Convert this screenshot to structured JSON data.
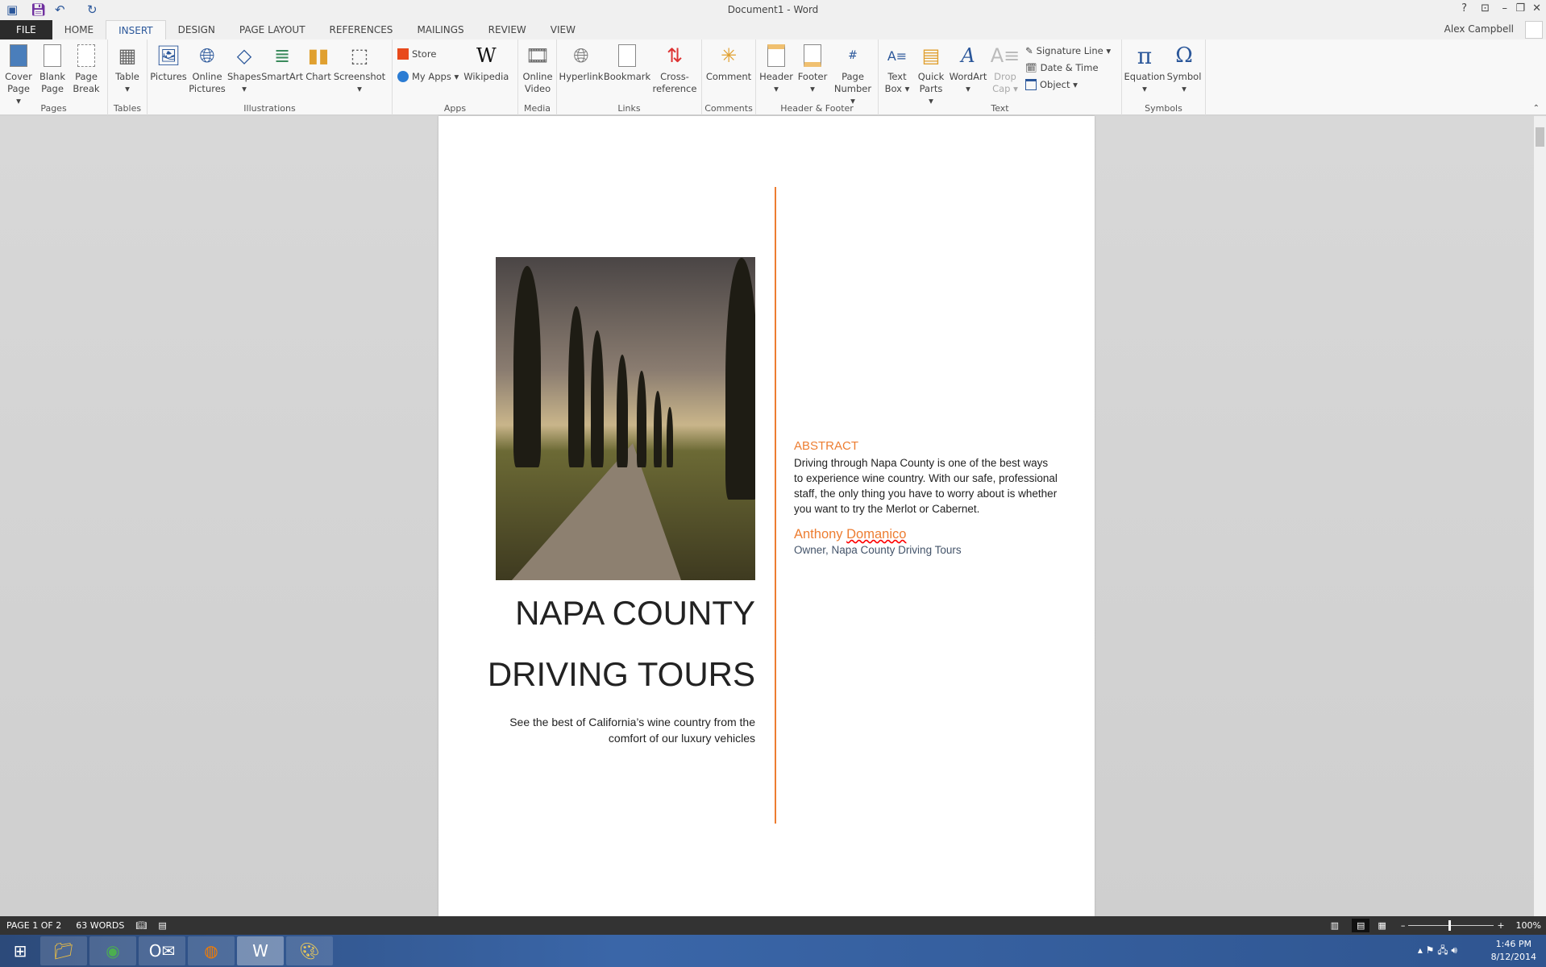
{
  "window": {
    "title": "Document1 - Word",
    "user": "Alex Campbell",
    "help": "?",
    "minimize": "–",
    "restore": "❐",
    "close": "✕"
  },
  "tabs": [
    "FILE",
    "HOME",
    "INSERT",
    "DESIGN",
    "PAGE LAYOUT",
    "REFERENCES",
    "MAILINGS",
    "REVIEW",
    "VIEW"
  ],
  "active_tab": "INSERT",
  "ribbon": {
    "pages": {
      "label": "Pages",
      "buttons": [
        "Cover Page ▾",
        "Blank Page",
        "Page Break"
      ]
    },
    "tables": {
      "label": "Tables",
      "buttons": [
        "Table ▾"
      ]
    },
    "illustrations": {
      "label": "Illustrations",
      "buttons": [
        "Pictures",
        "Online Pictures",
        "Shapes ▾",
        "SmartArt",
        "Chart",
        "Screenshot ▾"
      ]
    },
    "apps": {
      "label": "Apps",
      "store": "Store",
      "my_apps": "My Apps ▾",
      "wikipedia": "Wikipedia"
    },
    "media": {
      "label": "Media",
      "buttons": [
        "Online Video"
      ]
    },
    "links": {
      "label": "Links",
      "buttons": [
        "Hyperlink",
        "Bookmark",
        "Cross-reference"
      ]
    },
    "comments": {
      "label": "Comments",
      "buttons": [
        "Comment"
      ]
    },
    "header_footer": {
      "label": "Header & Footer",
      "buttons": [
        "Header ▾",
        "Footer ▾",
        "Page Number ▾"
      ]
    },
    "text": {
      "label": "Text",
      "buttons": [
        "Text Box ▾",
        "Quick Parts ▾",
        "WordArt ▾",
        "Drop Cap ▾"
      ],
      "signature_line": "Signature Line ▾",
      "date_time": "Date & Time",
      "object": "Object ▾"
    },
    "symbols": {
      "label": "Symbols",
      "buttons": [
        "Equation ▾",
        "Symbol ▾"
      ]
    }
  },
  "document": {
    "title_line1": "NAPA COUNTY",
    "title_line2": "DRIVING TOURS",
    "subtitle": "See the best of California’s wine country from the comfort of our luxury vehicles",
    "abstract_heading": "ABSTRACT",
    "abstract_body": "Driving through Napa County is one of the best ways to experience wine country. With our safe, professional staff, the only thing you have to worry about is whether you want to try the Merlot or Cabernet.",
    "author_first": "Anthony",
    "author_last": "Domanico",
    "author_role": "Owner, Napa County Driving Tours",
    "accent_color": "#ed7d31"
  },
  "status": {
    "page": "PAGE 1 OF 2",
    "words": "63 WORDS",
    "zoom": "100%",
    "zoom_percent": 100
  },
  "taskbar": {
    "apps": [
      "windows-start",
      "file-explorer",
      "chrome",
      "outlook",
      "firefox",
      "word",
      "paint"
    ],
    "time": "1:46 PM",
    "date": "8/12/2014"
  }
}
